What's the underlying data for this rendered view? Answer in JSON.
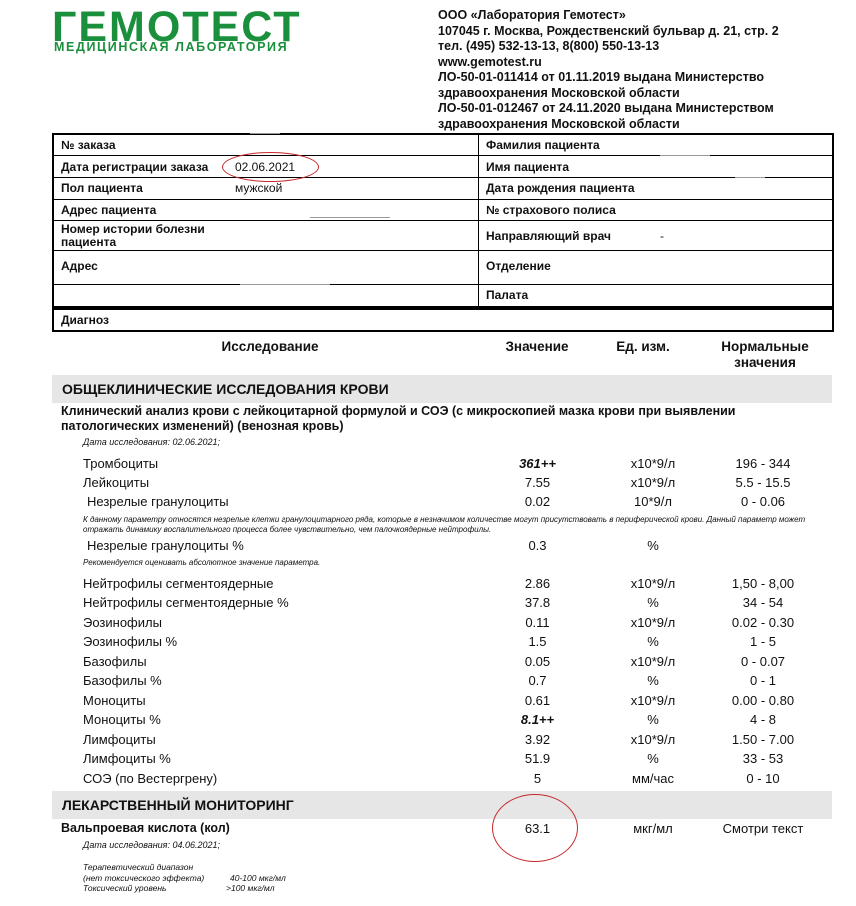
{
  "header": {
    "logo_main": "ГЕМОТЕСТ",
    "logo_sub": "МЕДИЦИНСКАЯ ЛАБОРАТОРИЯ",
    "company_lines": [
      "ООО «Лаборатория Гемотест»",
      "107045 г. Москва, Рождественский бульвар д. 21, стр. 2",
      "тел. (495) 532-13-13, 8(800) 550-13-13",
      "www.gemotest.ru",
      "ЛО-50-01-011414 от 01.11.2019 выдана Министерство",
      "здравоохранения Московской области",
      "ЛО-50-01-012467 от 24.11.2020 выдана Министерством",
      "здравоохранения Московской области"
    ]
  },
  "patient": {
    "order_no_label": "№ заказа",
    "reg_date_label": "Дата регистрации заказа",
    "reg_date_value": "02.06.2021",
    "sex_label": "Пол пациента",
    "sex_value": "мужской",
    "address_label": "Адрес пациента",
    "history_label_1": "Номер истории болезни",
    "history_label_2": "пациента",
    "addr_label": "Адрес",
    "surname_label": "Фамилия пациента",
    "name_label": "Имя пациента",
    "dob_label": "Дата рождения пациента",
    "policy_label": "№ страхового полиса",
    "doctor_label": "Направляющий врач",
    "doctor_value": "-",
    "dept_label": "Отделение",
    "ward_label": "Палата",
    "diagnosis_label": "Диагноз"
  },
  "table_header": {
    "study": "Исследование",
    "value": "Значение",
    "unit": "Ед. изм.",
    "normal_1": "Нормальные",
    "normal_2": "значения"
  },
  "section1": {
    "title": "ОБЩЕКЛИНИЧЕСКИЕ ИССЛЕДОВАНИЯ КРОВИ",
    "test_title": "Клинический анализ крови с лейкоцитарной формулой и СОЭ (с микроскопией мазка крови при выявлении патологических изменений) (венозная кровь)",
    "study_date": "Дата исследования: 02.06.2021;",
    "note_immature": "К данному параметру относятся незрелые клетки гранулоцитарного ряда, которые  в незначимом количестве могут присутствовать в периферической крови. Данный параметр может отражать динамику воспалительного процесса более чувствительно, чем палочкоядерные нейтрофилы.",
    "note_absolute": "Рекомендуется оценивать абсолютное значение параметра."
  },
  "rows": [
    {
      "name": "Тромбоциты",
      "value": "361++",
      "unit": "х10*9/л",
      "range": "196 - 344",
      "flag": true
    },
    {
      "name": "Лейкоциты",
      "value": "7.55",
      "unit": "х10*9/л",
      "range": "5.5 - 15.5"
    },
    {
      "name": "Незрелые гранулоциты",
      "value": "0.02",
      "unit": "10*9/л",
      "range": "0 - 0.06"
    },
    {
      "name": "Незрелые гранулоциты %",
      "value": "0.3",
      "unit": "%",
      "range": ""
    },
    {
      "name": "Нейтрофилы сегментоядерные",
      "value": "2.86",
      "unit": "х10*9/л",
      "range": "1,50 - 8,00"
    },
    {
      "name": "Нейтрофилы сегментоядерные %",
      "value": "37.8",
      "unit": "%",
      "range": "34 - 54"
    },
    {
      "name": "Эозинофилы",
      "value": "0.11",
      "unit": "х10*9/л",
      "range": "0.02 - 0.30"
    },
    {
      "name": "Эозинофилы %",
      "value": "1.5",
      "unit": "%",
      "range": "1 - 5"
    },
    {
      "name": "Базофилы",
      "value": "0.05",
      "unit": "х10*9/л",
      "range": "0 - 0.07"
    },
    {
      "name": "Базофилы %",
      "value": "0.7",
      "unit": "%",
      "range": "0 - 1"
    },
    {
      "name": "Моноциты",
      "value": "0.61",
      "unit": "х10*9/л",
      "range": "0.00 - 0.80"
    },
    {
      "name": "Моноциты %",
      "value": "8.1++",
      "unit": "%",
      "range": "4 - 8",
      "flag": true
    },
    {
      "name": "Лимфоциты",
      "value": "3.92",
      "unit": "х10*9/л",
      "range": "1.50 - 7.00"
    },
    {
      "name": "Лимфоциты %",
      "value": "51.9",
      "unit": "%",
      "range": "33 - 53"
    },
    {
      "name": "СОЭ (по Вестергрену)",
      "value": "5",
      "unit": "мм/час",
      "range": "0 - 10"
    }
  ],
  "section2": {
    "title": "ЛЕКАРСТВЕННЫЙ МОНИТОРИНГ",
    "test_name": "Вальпроевая кислота (кол)",
    "value": "63.1",
    "unit": "мкг/мл",
    "range": "Смотри текст",
    "study_date": "Дата исследования: 04.06.2021;",
    "ther_label_1": "Терапевтический диапазон",
    "ther_label_2": "(нет токсического эффекта)",
    "ther_value": "40-100 мкг/мл",
    "tox_label": "Токсический уровень",
    "tox_value": ">100  мкг/мл"
  },
  "colors": {
    "brand": "#1a8f3c",
    "annotation": "#c62828",
    "section_bg": "#e6e6e6"
  }
}
